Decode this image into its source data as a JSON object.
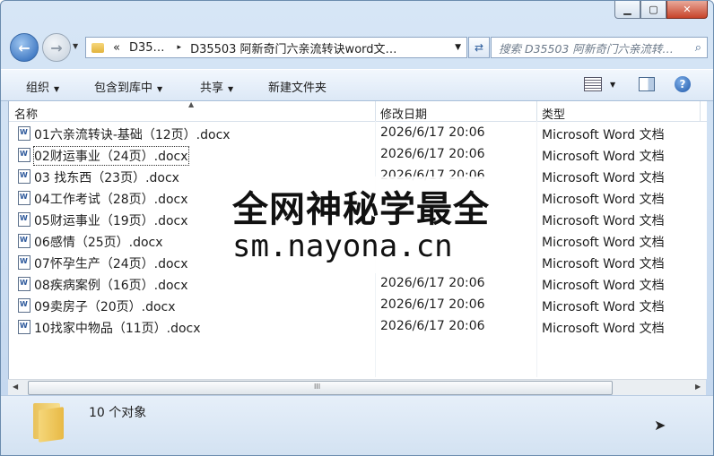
{
  "window": {
    "min_label": "▁",
    "max_label": "▢",
    "close_label": "✕"
  },
  "address": {
    "back_glyph": "←",
    "forward_glyph": "→",
    "breadcrumb_prefix": "«",
    "crumb1": "D35…",
    "crumb_sep": "▸",
    "crumb2": "D35503 阿新奇门六亲流转诀word文…",
    "search_placeholder": "搜索 D35503 阿新奇门六亲流转…"
  },
  "toolbar": {
    "organize": "组织",
    "include_library": "包含到库中",
    "share": "共享",
    "new_folder": "新建文件夹"
  },
  "columns": {
    "name": "名称",
    "date": "修改日期",
    "type": "类型"
  },
  "files": [
    {
      "name": "01六亲流转诀-基础（12页）.docx",
      "date": "2026/6/17 20:06",
      "type": "Microsoft Word 文档"
    },
    {
      "name": "02财运事业（24页）.docx",
      "date": "2026/6/17 20:06",
      "type": "Microsoft Word 文档"
    },
    {
      "name": "03 找东西（23页）.docx",
      "date": "2026/6/17 20:06",
      "type": "Microsoft Word 文档"
    },
    {
      "name": "04工作考试（28页）.docx",
      "date": "",
      "type": "Microsoft Word 文档"
    },
    {
      "name": "05财运事业（19页）.docx",
      "date": "",
      "type": "Microsoft Word 文档"
    },
    {
      "name": "06感情（25页）.docx",
      "date": "",
      "type": "Microsoft Word 文档"
    },
    {
      "name": "07怀孕生产（24页）.docx",
      "date": "",
      "type": "Microsoft Word 文档"
    },
    {
      "name": "08疾病案例（16页）.docx",
      "date": "2026/6/17 20:06",
      "type": "Microsoft Word 文档"
    },
    {
      "name": "09卖房子（20页）.docx",
      "date": "2026/6/17 20:06",
      "type": "Microsoft Word 文档"
    },
    {
      "name": "10找家中物品（11页）.docx",
      "date": "2026/6/17 20:06",
      "type": "Microsoft Word 文档"
    }
  ],
  "scrollbar": {
    "left_arrow": "◀",
    "right_arrow": "▶",
    "grip": "III"
  },
  "status": {
    "count": "10 个对象"
  },
  "watermark": {
    "line1": "全网神秘学最全",
    "line2": "sm.nayona.cn"
  }
}
